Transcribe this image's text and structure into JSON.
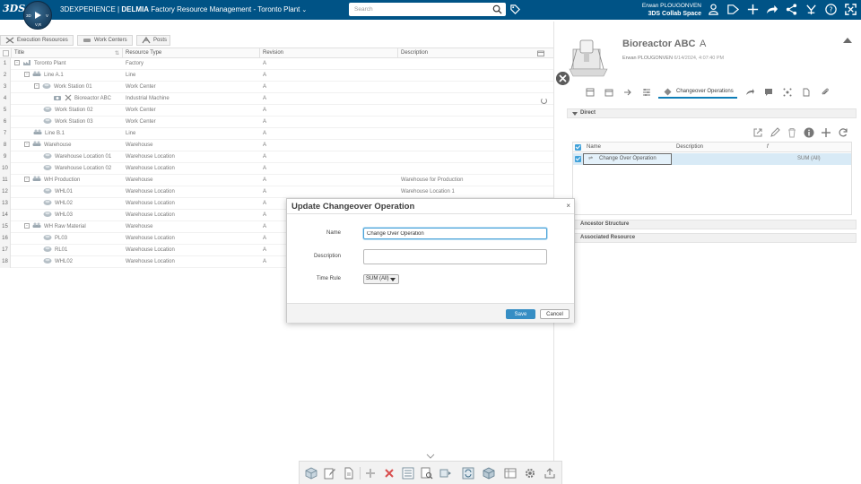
{
  "topbar": {
    "brand_logo": "3DS",
    "compass": {
      "left": "3D",
      "right": "V",
      "bottom": "V,R"
    },
    "product": "3DEXPERIENCE",
    "separator": " | ",
    "brand": "DELMIA",
    "app_name": " Factory Resource Management - Toronto Plant",
    "search_placeholder": "Search",
    "user_name": "Erwan PLOUGONVEN",
    "collab_space": "3DS Collab Space"
  },
  "tabs": [
    "Execution Resources",
    "Work Centers",
    "Posts"
  ],
  "grid": {
    "columns": [
      "Title",
      "Resource Type",
      "Revision",
      "Description"
    ],
    "rows": [
      {
        "num": "1",
        "title": "Toronto Plant",
        "type": "Factory",
        "rev": "A",
        "desc": ""
      },
      {
        "num": "2",
        "title": "Line A.1",
        "type": "Line",
        "rev": "A",
        "desc": ""
      },
      {
        "num": "3",
        "title": "Work Station 01",
        "type": "Work Center",
        "rev": "A",
        "desc": ""
      },
      {
        "num": "4",
        "title": "Bioreactor ABC",
        "type": "Industrial Machine",
        "rev": "A",
        "desc": ""
      },
      {
        "num": "5",
        "title": "Work Station 02",
        "type": "Work Center",
        "rev": "A",
        "desc": ""
      },
      {
        "num": "6",
        "title": "Work Station 03",
        "type": "Work Center",
        "rev": "A",
        "desc": ""
      },
      {
        "num": "7",
        "title": "Line B.1",
        "type": "Line",
        "rev": "A",
        "desc": ""
      },
      {
        "num": "8",
        "title": "Warehouse",
        "type": "Warehouse",
        "rev": "A",
        "desc": ""
      },
      {
        "num": "9",
        "title": "Warehouse Location 01",
        "type": "Warehouse Location",
        "rev": "A",
        "desc": ""
      },
      {
        "num": "10",
        "title": "Warehouse Location 02",
        "type": "Warehouse Location",
        "rev": "A",
        "desc": ""
      },
      {
        "num": "11",
        "title": "WH Production",
        "type": "Warehouse",
        "rev": "A",
        "desc": "Warehouse for Production"
      },
      {
        "num": "12",
        "title": "WHL01",
        "type": "Warehouse Location",
        "rev": "A",
        "desc": "Warehouse Location 1"
      },
      {
        "num": "13",
        "title": "WHL02",
        "type": "Warehouse Location",
        "rev": "A",
        "desc": ""
      },
      {
        "num": "14",
        "title": "WHL03",
        "type": "Warehouse Location",
        "rev": "A",
        "desc": ""
      },
      {
        "num": "15",
        "title": "WH Raw Material",
        "type": "Warehouse",
        "rev": "A",
        "desc": ""
      },
      {
        "num": "16",
        "title": "PL03",
        "type": "Warehouse Location",
        "rev": "A",
        "desc": ""
      },
      {
        "num": "17",
        "title": "RL01",
        "type": "Warehouse Location",
        "rev": "A",
        "desc": ""
      },
      {
        "num": "18",
        "title": "WHL02",
        "type": "Warehouse Location",
        "rev": "A",
        "desc": ""
      }
    ]
  },
  "details": {
    "title": "Bioreactor ABC",
    "revision": "A",
    "owner": "Erwan PLOUGONVEN",
    "date": "6/14/2024, 4:07:40 PM",
    "active_tab": "Changeover Operations",
    "sections": {
      "direct": "Direct",
      "ancestor": "Ancestor Structure",
      "associated": "Associated Resource"
    },
    "table": {
      "columns": [
        "Name",
        "Description",
        "f"
      ],
      "row": {
        "name": "Change Over Operation",
        "value": "SUM (All)"
      }
    }
  },
  "dialog": {
    "title": "Update Changeover Operation",
    "close": "×",
    "name_label": "Name",
    "name_value": "Change Over Operation",
    "description_label": "Description",
    "description_value": "",
    "time_rule_label": "Time Rule",
    "time_rule_value": "SUM (All)",
    "save": "Save",
    "cancel": "Cancel"
  },
  "colors": {
    "topbar": "#005386",
    "accent": "#368ec4",
    "selection": "#d8eaf6"
  }
}
